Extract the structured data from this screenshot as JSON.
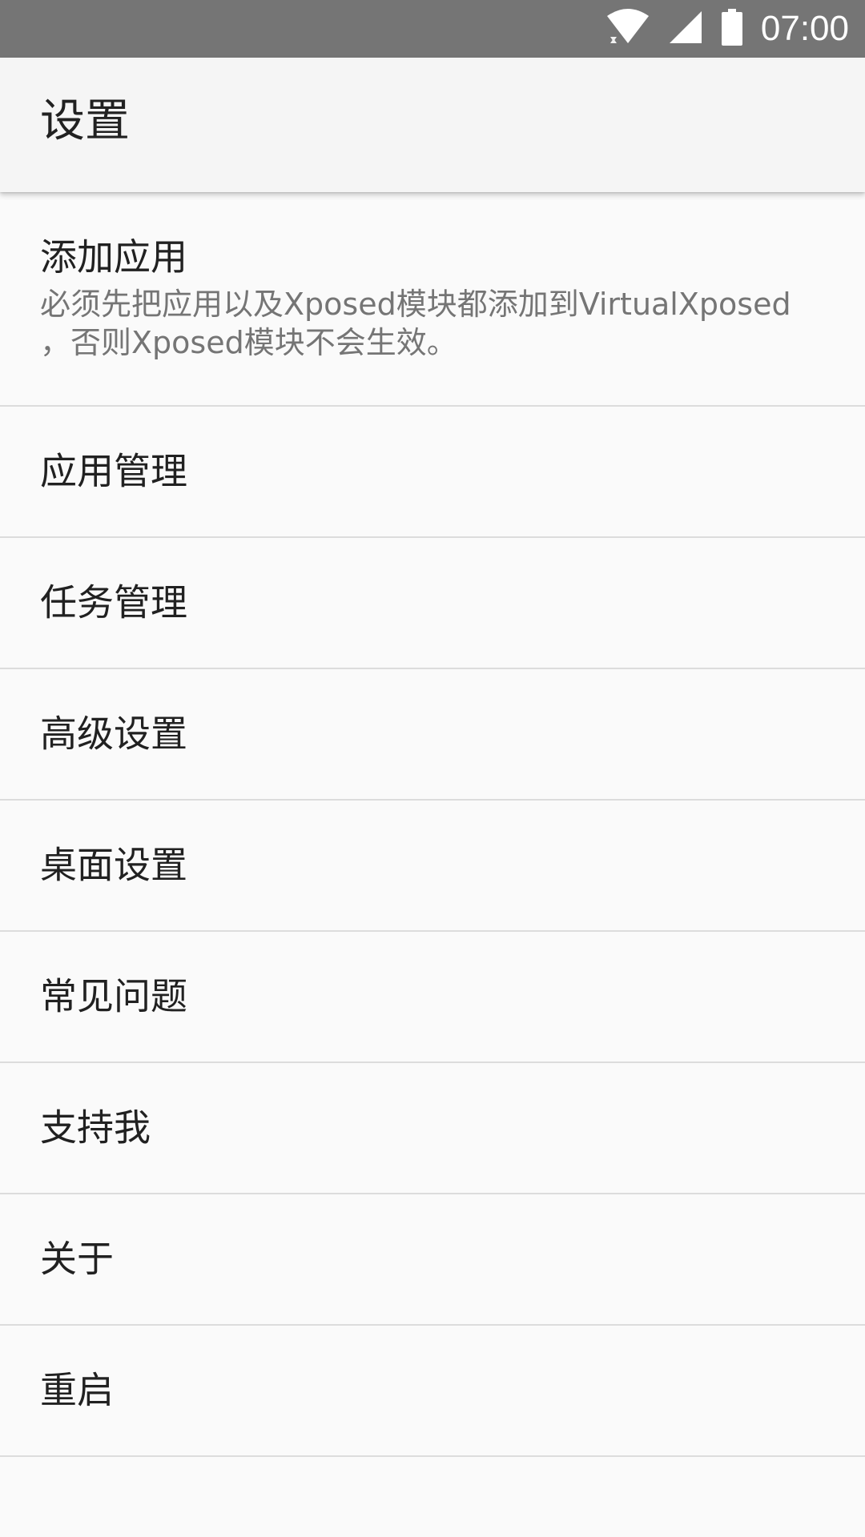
{
  "status_bar": {
    "time": "07:00",
    "icons": [
      "wifi-icon",
      "cell-signal-icon",
      "battery-icon"
    ]
  },
  "app_bar": {
    "title": "设置"
  },
  "settings": {
    "items": [
      {
        "title": "添加应用",
        "summary": "必须先把应用以及Xposed模块都添加到VirtualXposed ，否则Xposed模块不会生效。"
      },
      {
        "title": "应用管理"
      },
      {
        "title": "任务管理"
      },
      {
        "title": "高级设置"
      },
      {
        "title": "桌面设置"
      },
      {
        "title": "常见问题"
      },
      {
        "title": "支持我"
      },
      {
        "title": "关于"
      },
      {
        "title": "重启"
      }
    ]
  },
  "colors": {
    "status_bar": "#757575",
    "app_bar": "#f5f5f5",
    "background": "#fafafa",
    "divider": "#dcdcdc",
    "primary_text": "#212121",
    "secondary_text": "#757575"
  }
}
